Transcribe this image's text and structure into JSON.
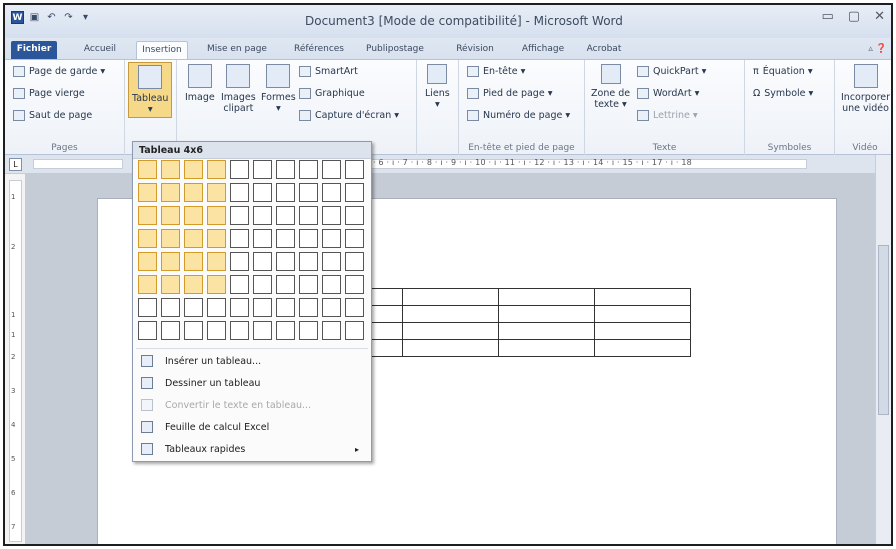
{
  "window": {
    "title": "Document3 [Mode de compatibilité] - Microsoft Word",
    "qat_logo": "W",
    "qat_icons": [
      "save-icon",
      "undo-icon",
      "redo-icon",
      "customize-icon"
    ],
    "controls": [
      "minimize-icon",
      "maximize-icon",
      "close-icon"
    ]
  },
  "tabs": [
    {
      "label": "Fichier"
    },
    {
      "label": "Accueil"
    },
    {
      "label": "Insertion"
    },
    {
      "label": "Mise en page"
    },
    {
      "label": "Références"
    },
    {
      "label": "Publipostage"
    },
    {
      "label": "Révision"
    },
    {
      "label": "Affichage"
    },
    {
      "label": "Acrobat"
    }
  ],
  "ribbon": {
    "pages": {
      "label": "Pages",
      "items": [
        "Page de garde ▾",
        "Page vierge",
        "Saut de page"
      ]
    },
    "tableau": {
      "label": "Tableau",
      "arrow": "▾"
    },
    "illustrations": {
      "image": "Image",
      "clipart_line1": "Images",
      "clipart_line2": "clipart",
      "formes": "Formes",
      "formes_arrow": "▾",
      "items": [
        "SmartArt",
        "Graphique",
        "Capture d'écran ▾"
      ]
    },
    "liens": {
      "label": "Liens",
      "arrow": "▾"
    },
    "header_footer": {
      "label": "En-tête et pied de page",
      "items": [
        "En-tête ▾",
        "Pied de page ▾",
        "Numéro de page ▾"
      ]
    },
    "texte": {
      "label": "Texte",
      "zone_line1": "Zone de",
      "zone_line2": "texte ▾",
      "items": [
        "QuickPart ▾",
        "WordArt ▾",
        "Lettrine ▾"
      ]
    },
    "symboles": {
      "label": "Symboles",
      "items": [
        "Équation ▾",
        "Symbole ▾"
      ]
    },
    "video": {
      "label": "Vidéo",
      "line1": "Incorporer",
      "line2": "une vidéo"
    }
  },
  "ruler": {
    "corner": "L",
    "text": "· 6 · ı · 7 · ı · 8 · ı · 9 · ı · 10 · ı · 11 · ı · 12 · ı · 13 · ı · 14 · ı · 15 · ı ·        17 · ı · 18",
    "vertical_marks": [
      "1",
      "2",
      "1",
      "1",
      "2",
      "3",
      "4",
      "5",
      "6",
      "7"
    ]
  },
  "dropdown": {
    "title": "Tableau 4x6",
    "grid_cols": 10,
    "grid_rows": 8,
    "selected_cols": 4,
    "selected_rows": 6,
    "items": [
      {
        "label": "Insérer un tableau...",
        "enabled": true,
        "icon": "insert-table-icon"
      },
      {
        "label": "Dessiner un tableau",
        "enabled": true,
        "icon": "draw-table-icon"
      },
      {
        "label": "Convertir le texte en tableau...",
        "enabled": false,
        "icon": "convert-text-icon"
      },
      {
        "label": "Feuille de calcul Excel",
        "enabled": true,
        "icon": "excel-sheet-icon"
      },
      {
        "label": "Tableaux rapides",
        "enabled": true,
        "icon": "quick-tables-icon",
        "submenu": "▸"
      }
    ]
  },
  "document": {
    "preview_table_rows": 4,
    "preview_table_cols": 4
  }
}
